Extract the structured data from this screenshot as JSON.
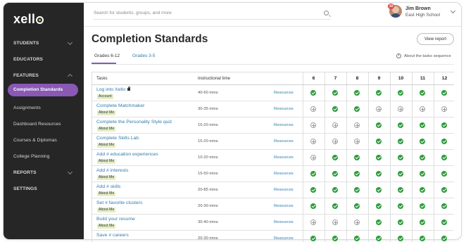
{
  "app": {
    "logo": "xello"
  },
  "sidebar": {
    "items": [
      {
        "label": "STUDENTS",
        "type": "section",
        "chevron": "chevron-down-icon"
      },
      {
        "label": "EDUCATORS",
        "type": "section"
      },
      {
        "label": "FEATURES",
        "type": "section",
        "chevron": "chevron-up-icon"
      },
      {
        "label": "Completion Standards",
        "type": "link",
        "active": true
      },
      {
        "label": "Assignments",
        "type": "link"
      },
      {
        "label": "Dashboard Resources",
        "type": "link"
      },
      {
        "label": "Courses & Diplomas",
        "type": "link"
      },
      {
        "label": "College Planning",
        "type": "link"
      },
      {
        "label": "REPORTS",
        "type": "section",
        "chevron": "chevron-down-icon"
      },
      {
        "label": "SETTINGS",
        "type": "section"
      }
    ]
  },
  "topbar": {
    "search_placeholder": "Search for students, groups, and more",
    "notification_count": "10",
    "user_name": "Jim Brown",
    "user_school": "East High School"
  },
  "main": {
    "title": "Completion Standards",
    "view_report_label": "View report",
    "tabs": [
      {
        "label": "Grades 6-12",
        "active": true
      },
      {
        "label": "Grades 3-5",
        "active": false
      }
    ],
    "about_label": "About the tasks sequence"
  },
  "table": {
    "headers": {
      "tasks": "Tasks",
      "time": "Instructional time"
    },
    "grades": [
      "6",
      "7",
      "8",
      "9",
      "10",
      "11",
      "12"
    ],
    "rows": [
      {
        "task": "Log into Xello",
        "locked": true,
        "tag": "Account",
        "time": "40-60 mins",
        "resources": "Resources",
        "status": [
          1,
          1,
          1,
          1,
          1,
          1,
          1
        ]
      },
      {
        "task": "Complete Matchmaker",
        "locked": false,
        "tag": "About Me",
        "time": "30-35 mins",
        "resources": "Resources",
        "status": [
          0,
          1,
          1,
          0,
          0,
          0,
          0
        ]
      },
      {
        "task": "Complete the Personality Style quiz",
        "locked": false,
        "tag": "About Me",
        "time": "15-20 mins",
        "resources": "Resources",
        "status": [
          0,
          0,
          0,
          1,
          1,
          1,
          1
        ]
      },
      {
        "task": "Complete Skills Lab",
        "locked": false,
        "tag": "About Me",
        "time": "15-20 mins",
        "resources": "Resources",
        "status": [
          0,
          0,
          0,
          1,
          1,
          1,
          1
        ]
      },
      {
        "task": "Add # education experiences",
        "locked": false,
        "tag": "About Me",
        "time": "10-20 mins",
        "resources": "Resources",
        "status": [
          0,
          1,
          1,
          1,
          1,
          1,
          1
        ]
      },
      {
        "task": "Add # interests",
        "locked": false,
        "tag": "About Me",
        "time": "15-50 mins",
        "resources": "Resources",
        "status": [
          1,
          1,
          1,
          1,
          1,
          1,
          1
        ]
      },
      {
        "task": "Add # skills",
        "locked": false,
        "tag": "About Me",
        "time": "20-85 mins",
        "resources": "Resources",
        "status": [
          1,
          1,
          1,
          1,
          1,
          1,
          1
        ]
      },
      {
        "task": "Set # favorite clusters",
        "locked": false,
        "tag": "About Me",
        "time": "20-30 mins",
        "resources": "Resources",
        "status": [
          1,
          1,
          1,
          1,
          1,
          1,
          1
        ]
      },
      {
        "task": "Build your resume",
        "locked": false,
        "tag": "About Me",
        "time": "30-40 mins",
        "resources": "Resources",
        "status": [
          0,
          0,
          0,
          1,
          1,
          1,
          1
        ]
      },
      {
        "task": "Save # careers",
        "locked": false,
        "tag": "",
        "time": "20-30 mins",
        "resources": "Resources",
        "status": [
          1,
          1,
          1,
          1,
          1,
          1,
          1
        ]
      }
    ]
  },
  "colors": {
    "sidebar_bg": "#262626",
    "accent": "#8a58b5",
    "link": "#2e7cae",
    "check": "#2e9b3b",
    "tag_bg": "#e3eec4"
  }
}
